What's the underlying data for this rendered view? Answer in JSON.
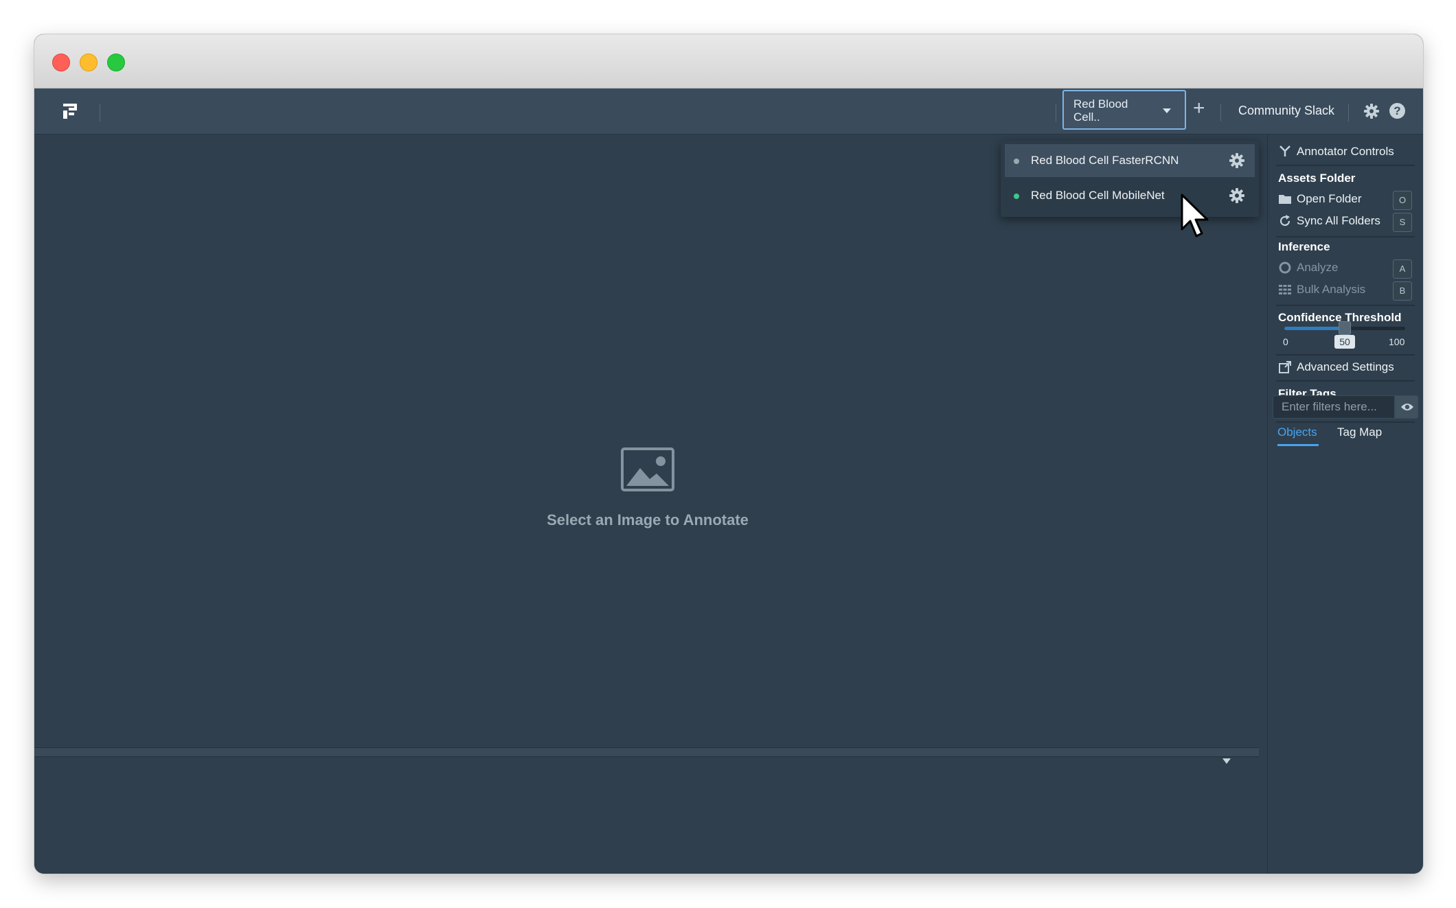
{
  "toolbar": {
    "project_select_label": "Red Blood Cell..",
    "add_label": "+",
    "community_link": "Community Slack"
  },
  "canvas": {
    "placeholder_text": "Select an Image to Annotate"
  },
  "project_dropdown": {
    "items": [
      {
        "label": "Red Blood Cell FasterRCNN",
        "status_color": "#9aa8b2",
        "highlighted": true
      },
      {
        "label": "Red Blood Cell MobileNet",
        "status_color": "#3ec98a",
        "highlighted": false
      }
    ]
  },
  "sidebar": {
    "annotator_controls": "Annotator Controls",
    "assets_folder": {
      "title": "Assets Folder",
      "open_folder": "Open Folder",
      "open_folder_key": "O",
      "sync_all": "Sync All Folders",
      "sync_all_key": "S"
    },
    "inference": {
      "title": "Inference",
      "analyze": "Analyze",
      "analyze_key": "A",
      "bulk_analysis": "Bulk Analysis",
      "bulk_analysis_key": "B"
    },
    "confidence": {
      "title": "Confidence Threshold",
      "min": "0",
      "max": "100",
      "value": "50",
      "value_num": 50
    },
    "advanced_settings": "Advanced Settings",
    "filter_tags": {
      "title": "Filter Tags",
      "placeholder": "Enter filters here..."
    },
    "tabs": [
      {
        "label": "Objects",
        "active": true
      },
      {
        "label": "Tag Map",
        "active": false
      }
    ]
  },
  "colors": {
    "accent": "#4aa3f0",
    "background": "#2f3f4d",
    "toolbar": "#3a4b5b"
  }
}
